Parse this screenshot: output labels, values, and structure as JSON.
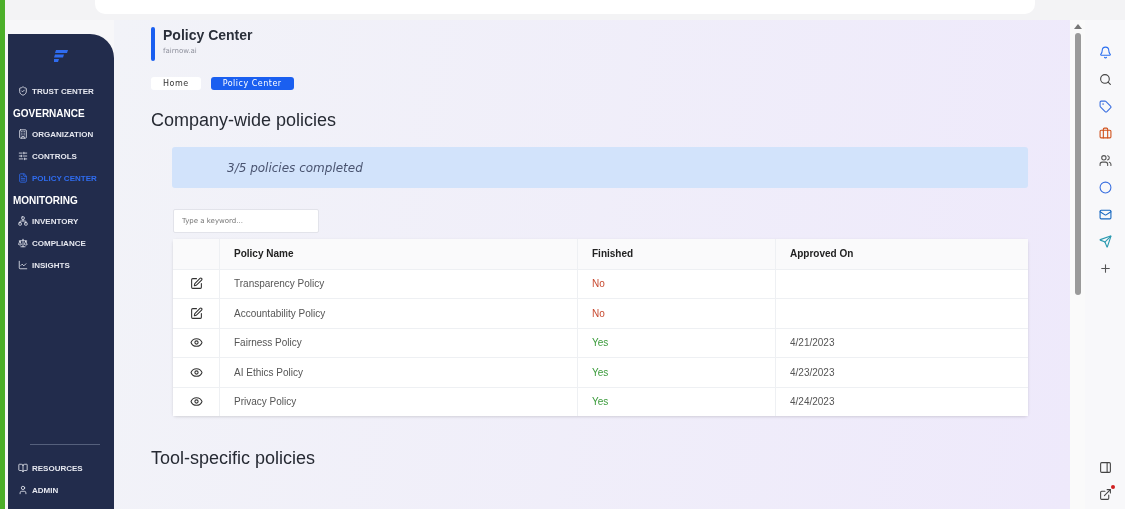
{
  "sidebar": {
    "top_item": {
      "label": "TRUST CENTER",
      "selected": false
    },
    "sections": [
      {
        "title": "GOVERNANCE",
        "items": [
          {
            "label": "ORGANIZATION",
            "selected": false
          },
          {
            "label": "CONTROLS",
            "selected": false
          },
          {
            "label": "POLICY CENTER",
            "selected": true
          }
        ]
      },
      {
        "title": "MONITORING",
        "items": [
          {
            "label": "INVENTORY",
            "selected": false
          },
          {
            "label": "COMPLIANCE",
            "selected": false
          },
          {
            "label": "INSIGHTS",
            "selected": false
          }
        ]
      }
    ],
    "bottom_items": [
      {
        "label": "RESOURCES",
        "selected": false
      },
      {
        "label": "ADMIN",
        "selected": false
      }
    ]
  },
  "header": {
    "title": "Policy Center",
    "subtitle": "fairnow.ai"
  },
  "breadcrumbs": [
    {
      "label": "Home",
      "selected": false
    },
    {
      "label": "Policy Center",
      "selected": true
    }
  ],
  "section_title": "Company-wide policies",
  "progress_banner": "3/5 policies completed",
  "search": {
    "placeholder": "Type a keyword..."
  },
  "table": {
    "columns": [
      "Policy Name",
      "Finished",
      "Approved On"
    ],
    "rows": [
      {
        "name": "Transparency Policy",
        "finished": "No",
        "done": false
      },
      {
        "name": "Accountability Policy",
        "finished": "No",
        "done": false
      },
      {
        "name": "Fairness Policy",
        "finished": "Yes",
        "done": true,
        "approved_on": "4/21/2023"
      },
      {
        "name": "AI Ethics Policy",
        "finished": "Yes",
        "done": true,
        "approved_on": "4/23/2023"
      },
      {
        "name": "Privacy Policy",
        "finished": "Yes",
        "done": true,
        "approved_on": "4/24/2023"
      }
    ]
  },
  "next_section_title": "Tool-specific policies"
}
